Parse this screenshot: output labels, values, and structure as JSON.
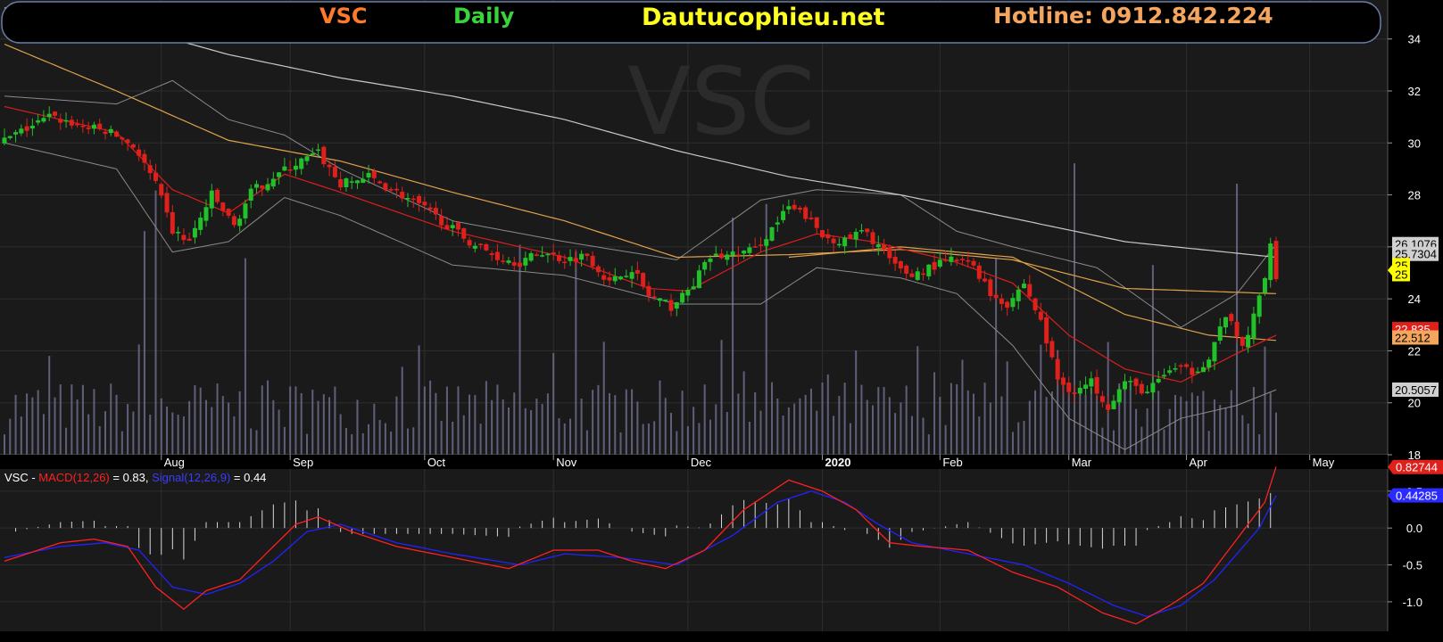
{
  "header": {
    "symbol": "VSC",
    "period": "Daily",
    "site": "Dautucophieu.net",
    "hotline": "Hotline: 0912.842.224"
  },
  "colors": {
    "background": "#000000",
    "panel": "#1a1a1a",
    "grid": "#2e2e2e",
    "up": "#22c12a",
    "down": "#e0201b",
    "volume": "#6c6c8c",
    "ma_red": "#d81e1e",
    "ma_orange": "#e0a24a",
    "ma_white": "#c8c8c8",
    "bollinger": "#8a8a8a",
    "macd": "#ff2020",
    "signal": "#2222ff",
    "histogram": "#d8d8d8"
  },
  "chart_data": [
    {
      "type": "candlestick",
      "watermark": "VSC",
      "x_ticks": [
        "Aug",
        "Sep",
        "Oct",
        "Nov",
        "Dec",
        "2020",
        "Feb",
        "Mar",
        "Apr",
        "May"
      ],
      "y_ticks": [
        "34",
        "32",
        "30",
        "28",
        "26",
        "24",
        "22",
        "20",
        "18"
      ],
      "ylim": [
        18,
        35.5
      ],
      "price_labels": [
        {
          "text": "26.1076",
          "value": 26.1076
        },
        {
          "text": "25.7304",
          "value": 25.7304
        },
        {
          "text": "25",
          "value": 25.3
        },
        {
          "text": "25",
          "value": 24.95
        },
        {
          "text": "22.835",
          "value": 22.835
        },
        {
          "text": "22.512",
          "value": 22.512
        },
        {
          "text": "20.5057",
          "value": 20.5057
        }
      ],
      "close_path": [
        [
          0,
          30.1
        ],
        [
          8,
          31.0
        ],
        [
          15,
          30.6
        ],
        [
          19,
          30.4
        ],
        [
          23,
          29.9
        ],
        [
          27,
          28.4
        ],
        [
          30,
          26.6
        ],
        [
          33,
          26.2
        ],
        [
          37,
          28.0
        ],
        [
          41,
          26.8
        ],
        [
          44,
          28.1
        ],
        [
          48,
          28.7
        ],
        [
          52,
          29.2
        ],
        [
          56,
          29.6
        ],
        [
          60,
          28.4
        ],
        [
          65,
          28.7
        ],
        [
          70,
          28.1
        ],
        [
          74,
          27.6
        ],
        [
          78,
          27.0
        ],
        [
          83,
          26.2
        ],
        [
          88,
          25.6
        ],
        [
          92,
          25.4
        ],
        [
          96,
          25.8
        ],
        [
          100,
          25.5
        ],
        [
          104,
          25.7
        ],
        [
          108,
          24.6
        ],
        [
          112,
          25.2
        ],
        [
          115,
          24.1
        ],
        [
          119,
          23.7
        ],
        [
          122,
          24.3
        ],
        [
          126,
          25.6
        ],
        [
          130,
          25.7
        ],
        [
          134,
          25.9
        ],
        [
          137,
          26.7
        ],
        [
          140,
          27.5
        ],
        [
          143,
          27.2
        ],
        [
          146,
          26.4
        ],
        [
          150,
          26.2
        ],
        [
          153,
          26.6
        ],
        [
          156,
          26.1
        ],
        [
          159,
          25.2
        ],
        [
          162,
          24.9
        ],
        [
          165,
          25.2
        ],
        [
          169,
          25.5
        ],
        [
          173,
          25.3
        ],
        [
          176,
          24.2
        ],
        [
          179,
          23.8
        ],
        [
          182,
          24.6
        ],
        [
          185,
          23.1
        ],
        [
          188,
          20.9
        ],
        [
          191,
          20.4
        ],
        [
          194,
          20.8
        ],
        [
          197,
          19.9
        ],
        [
          200,
          20.8
        ],
        [
          204,
          20.4
        ],
        [
          208,
          21.3
        ],
        [
          212,
          21.2
        ],
        [
          215,
          21.7
        ],
        [
          218,
          23.4
        ],
        [
          221,
          22.1
        ],
        [
          223,
          23.3
        ],
        [
          225,
          24.8
        ],
        [
          226,
          26.3
        ],
        [
          227,
          24.9
        ]
      ],
      "ma_white": [
        [
          0,
          35.2
        ],
        [
          20,
          34.6
        ],
        [
          40,
          33.4
        ],
        [
          60,
          32.5
        ],
        [
          80,
          31.8
        ],
        [
          100,
          30.9
        ],
        [
          120,
          29.7
        ],
        [
          140,
          28.7
        ],
        [
          160,
          28.0
        ],
        [
          180,
          27.1
        ],
        [
          200,
          26.2
        ],
        [
          227,
          25.6
        ]
      ],
      "ma_orange": [
        [
          0,
          33.8
        ],
        [
          20,
          32.0
        ],
        [
          40,
          30.1
        ],
        [
          60,
          29.3
        ],
        [
          80,
          28.1
        ],
        [
          100,
          27.0
        ],
        [
          120,
          25.6
        ],
        [
          140,
          25.7
        ],
        [
          160,
          25.9
        ],
        [
          180,
          25.5
        ],
        [
          200,
          24.4
        ],
        [
          227,
          24.2
        ]
      ],
      "ma_red": [
        [
          0,
          31.4
        ],
        [
          20,
          30.4
        ],
        [
          30,
          28.2
        ],
        [
          40,
          27.3
        ],
        [
          50,
          28.8
        ],
        [
          60,
          28.1
        ],
        [
          80,
          26.6
        ],
        [
          100,
          25.6
        ],
        [
          115,
          24.4
        ],
        [
          122,
          24.3
        ],
        [
          135,
          25.8
        ],
        [
          145,
          26.5
        ],
        [
          155,
          26.2
        ],
        [
          170,
          25.4
        ],
        [
          180,
          24.6
        ],
        [
          190,
          22.6
        ],
        [
          200,
          21.3
        ],
        [
          210,
          20.8
        ],
        [
          220,
          21.9
        ],
        [
          227,
          22.6
        ]
      ],
      "ma_orange_low": [
        [
          140,
          25.6
        ],
        [
          160,
          26.0
        ],
        [
          180,
          25.6
        ],
        [
          200,
          23.4
        ],
        [
          215,
          22.6
        ],
        [
          227,
          22.4
        ]
      ],
      "bollinger_upper": [
        [
          0,
          31.8
        ],
        [
          20,
          31.5
        ],
        [
          30,
          32.4
        ],
        [
          40,
          30.9
        ],
        [
          50,
          30.3
        ],
        [
          60,
          29.0
        ],
        [
          80,
          27.0
        ],
        [
          100,
          26.2
        ],
        [
          120,
          25.5
        ],
        [
          135,
          27.8
        ],
        [
          145,
          28.2
        ],
        [
          160,
          28.0
        ],
        [
          170,
          26.6
        ],
        [
          180,
          26.0
        ],
        [
          195,
          25.2
        ],
        [
          210,
          22.9
        ],
        [
          220,
          24.2
        ],
        [
          227,
          26.1
        ]
      ],
      "bollinger_lower": [
        [
          0,
          30.0
        ],
        [
          20,
          29.0
        ],
        [
          30,
          25.8
        ],
        [
          40,
          26.2
        ],
        [
          50,
          27.9
        ],
        [
          60,
          27.2
        ],
        [
          80,
          25.3
        ],
        [
          100,
          24.9
        ],
        [
          120,
          23.8
        ],
        [
          135,
          23.8
        ],
        [
          145,
          25.2
        ],
        [
          160,
          24.8
        ],
        [
          170,
          24.2
        ],
        [
          180,
          22.2
        ],
        [
          190,
          19.4
        ],
        [
          200,
          18.2
        ],
        [
          210,
          19.4
        ],
        [
          220,
          19.9
        ],
        [
          227,
          20.5
        ]
      ],
      "volume_spikes": [
        [
          25,
          0.66
        ],
        [
          27,
          0.78
        ],
        [
          43,
          0.58
        ],
        [
          92,
          0.62
        ],
        [
          102,
          0.6
        ],
        [
          130,
          0.7
        ],
        [
          136,
          0.74
        ],
        [
          177,
          0.58
        ],
        [
          191,
          0.86
        ],
        [
          205,
          0.56
        ],
        [
          220,
          0.8
        ]
      ]
    },
    {
      "type": "line",
      "legend": {
        "prefix": "VSC - ",
        "macd_label": "MACD(12,26)",
        "macd_value": " = 0.83, ",
        "signal_label": "Signal(12,26,9)",
        "signal_value": " = 0.44"
      },
      "y_ticks": [
        "0.5",
        "0.0",
        "-0.5",
        "-1.0"
      ],
      "ylim": [
        -1.4,
        0.8
      ],
      "value_labels": [
        {
          "text": "0.82744",
          "value": 0.82744
        },
        {
          "text": "0.44285",
          "value": 0.44285
        }
      ],
      "series": [
        {
          "key": "macd",
          "values": [
            [
              0,
              -0.45
            ],
            [
              10,
              -0.2
            ],
            [
              16,
              -0.15
            ],
            [
              22,
              -0.25
            ],
            [
              27,
              -0.8
            ],
            [
              32,
              -1.1
            ],
            [
              36,
              -0.85
            ],
            [
              42,
              -0.7
            ],
            [
              46,
              -0.4
            ],
            [
              52,
              0.05
            ],
            [
              56,
              0.15
            ],
            [
              62,
              -0.05
            ],
            [
              70,
              -0.25
            ],
            [
              80,
              -0.4
            ],
            [
              90,
              -0.55
            ],
            [
              98,
              -0.3
            ],
            [
              106,
              -0.3
            ],
            [
              112,
              -0.45
            ],
            [
              118,
              -0.55
            ],
            [
              125,
              -0.3
            ],
            [
              132,
              0.25
            ],
            [
              140,
              0.65
            ],
            [
              146,
              0.5
            ],
            [
              152,
              0.25
            ],
            [
              158,
              -0.2
            ],
            [
              164,
              -0.25
            ],
            [
              172,
              -0.3
            ],
            [
              180,
              -0.6
            ],
            [
              188,
              -0.8
            ],
            [
              196,
              -1.15
            ],
            [
              202,
              -1.3
            ],
            [
              208,
              -1.05
            ],
            [
              214,
              -0.75
            ],
            [
              218,
              -0.35
            ],
            [
              222,
              0.05
            ],
            [
              225,
              0.35
            ],
            [
              227,
              0.83
            ]
          ]
        },
        {
          "key": "signal",
          "values": [
            [
              0,
              -0.4
            ],
            [
              10,
              -0.25
            ],
            [
              18,
              -0.2
            ],
            [
              24,
              -0.3
            ],
            [
              30,
              -0.8
            ],
            [
              36,
              -0.9
            ],
            [
              42,
              -0.75
            ],
            [
              48,
              -0.45
            ],
            [
              54,
              -0.05
            ],
            [
              60,
              0.05
            ],
            [
              70,
              -0.2
            ],
            [
              80,
              -0.35
            ],
            [
              92,
              -0.5
            ],
            [
              100,
              -0.35
            ],
            [
              110,
              -0.4
            ],
            [
              120,
              -0.5
            ],
            [
              130,
              -0.1
            ],
            [
              138,
              0.35
            ],
            [
              144,
              0.5
            ],
            [
              150,
              0.35
            ],
            [
              156,
              0.05
            ],
            [
              162,
              -0.2
            ],
            [
              172,
              -0.35
            ],
            [
              182,
              -0.5
            ],
            [
              190,
              -0.75
            ],
            [
              198,
              -1.05
            ],
            [
              204,
              -1.2
            ],
            [
              210,
              -1.05
            ],
            [
              216,
              -0.7
            ],
            [
              220,
              -0.35
            ],
            [
              224,
              0.0
            ],
            [
              227,
              0.44
            ]
          ]
        }
      ]
    }
  ]
}
